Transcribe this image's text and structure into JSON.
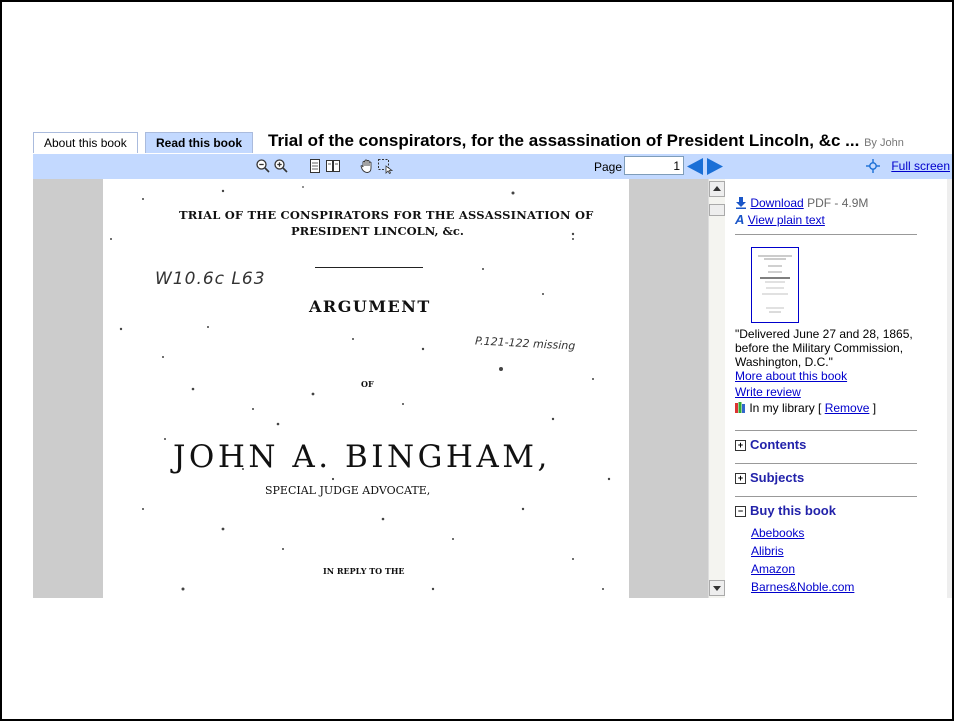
{
  "tabs": [
    {
      "label": "About this book"
    },
    {
      "label": "Read this book"
    }
  ],
  "book": {
    "title": "Trial of the conspirators, for the assassination of President Lincoln, &c ...",
    "by": "By John"
  },
  "toolbar": {
    "page_label": "Page",
    "page_value": "1",
    "fullscreen_label": "Full screen"
  },
  "page_scan": {
    "line1": "TRIAL OF THE CONSPIRATORS FOR THE ASSASSINATION OF",
    "line2": "PRESIDENT LINCOLN, &c.",
    "handwritten_callno": "W10.6c L63",
    "argument": "ARGUMENT",
    "handwritten_note": "P.121-122 missing",
    "of": "OF",
    "name": "JOHN A. BINGHAM,",
    "role": "SPECIAL JUDGE ADVOCATE,",
    "reply": "IN REPLY TO THE"
  },
  "sidebar": {
    "download_label": "Download",
    "download_info": "PDF - 4.9M",
    "plain_text_label": "View plain text",
    "description": [
      "\"Delivered June 27 and 28, 1865,",
      "before the Military Commission,",
      "Washington, D.C.\""
    ],
    "more_about": "More about this book",
    "write_review": "Write review",
    "in_library": "In my library [",
    "remove": "Remove",
    "in_library_end": "]",
    "contents": "Contents",
    "subjects": "Subjects",
    "buy": "Buy this book",
    "sellers": [
      "Abebooks",
      "Alibris",
      "Amazon",
      "Barnes&Noble.com"
    ]
  },
  "colors": {
    "toolbar_bg": "#c3d9ff",
    "link": "#0000cc",
    "nav_arrow": "#1a6fd6"
  },
  "icons": [
    "zoom-out-icon",
    "zoom-in-icon",
    "one-page-icon",
    "two-page-icon",
    "hand-tool-icon",
    "select-tool-icon",
    "prev-page-icon",
    "next-page-icon",
    "fullscreen-icon",
    "download-icon",
    "plain-text-icon",
    "library-icon"
  ]
}
